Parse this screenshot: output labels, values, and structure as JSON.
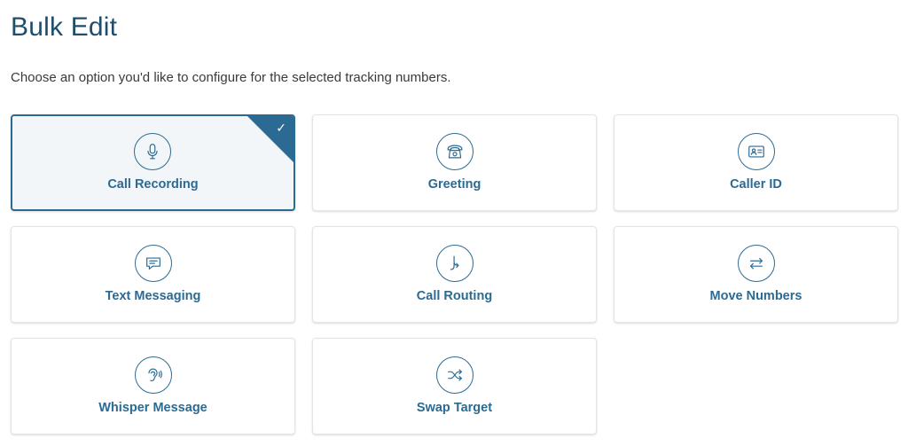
{
  "page": {
    "title": "Bulk Edit",
    "subtitle": "Choose an option you'd like to configure for the selected tracking numbers."
  },
  "options": [
    {
      "label": "Call Recording",
      "icon": "microphone-icon",
      "selected": true
    },
    {
      "label": "Greeting",
      "icon": "telephone-icon",
      "selected": false
    },
    {
      "label": "Caller ID",
      "icon": "id-card-icon",
      "selected": false
    },
    {
      "label": "Text Messaging",
      "icon": "chat-bubble-icon",
      "selected": false
    },
    {
      "label": "Call Routing",
      "icon": "routing-arrow-icon",
      "selected": false
    },
    {
      "label": "Move Numbers",
      "icon": "swap-arrows-icon",
      "selected": false
    },
    {
      "label": "Whisper Message",
      "icon": "ear-icon",
      "selected": false
    },
    {
      "label": "Swap Target",
      "icon": "shuffle-icon",
      "selected": false
    }
  ],
  "selected_check": "✓",
  "colors": {
    "accent": "#2a6a93",
    "title": "#1f4e6b",
    "selected_bg": "#f2f6f9"
  }
}
